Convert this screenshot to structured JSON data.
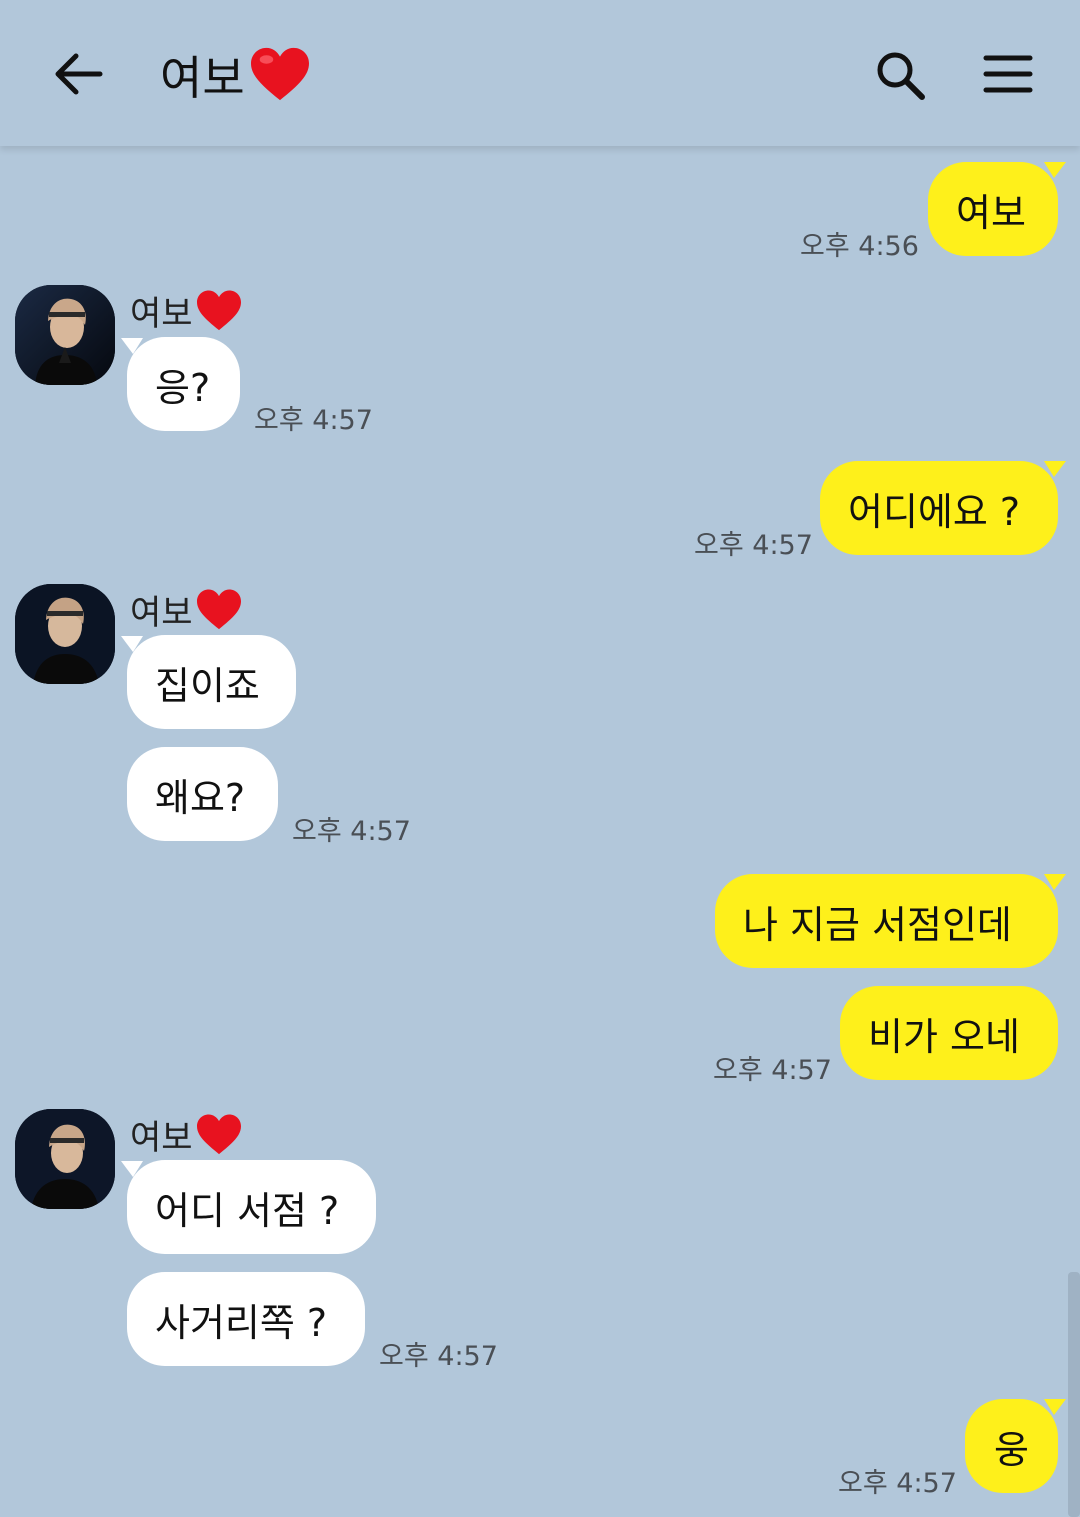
{
  "header": {
    "title": "여보"
  },
  "messages": [
    {
      "text": "여보",
      "time": "오후 4:56"
    },
    {
      "sender": "여보",
      "text": "응?",
      "time": "오후 4:57"
    },
    {
      "text": "어디에요 ?",
      "time": "오후 4:57"
    },
    {
      "sender": "여보",
      "text": "집이죠"
    },
    {
      "text": "왜요?",
      "time": "오후 4:57"
    },
    {
      "text": "나 지금 서점인데"
    },
    {
      "text": "비가 오네",
      "time": "오후 4:57"
    },
    {
      "sender": "여보",
      "text": "어디 서점 ?"
    },
    {
      "text": "사거리쪽 ?",
      "time": "오후 4:57"
    },
    {
      "text": "웅",
      "time": "오후 4:57"
    }
  ],
  "colors": {
    "background": "#b2c7da",
    "outgoing_bubble": "#fef01b",
    "incoming_bubble": "#ffffff",
    "heart": "#e8121f"
  },
  "icons": [
    "back-arrow-icon",
    "heart-icon",
    "search-icon",
    "menu-icon"
  ]
}
